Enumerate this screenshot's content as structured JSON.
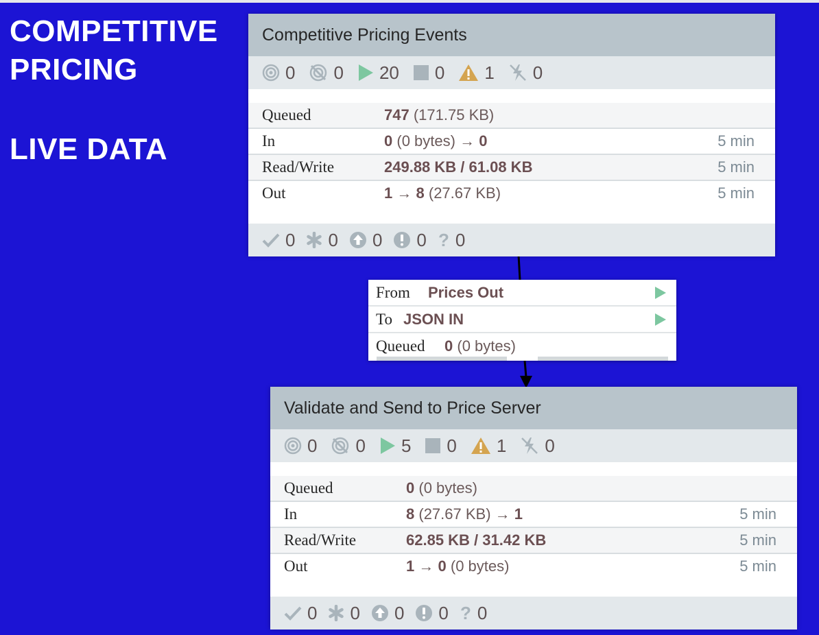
{
  "label": {
    "line1": "COMPETITIVE",
    "line2": "PRICING",
    "line3": "LIVE DATA"
  },
  "groups": [
    {
      "title": "Competitive Pricing Events",
      "counts": {
        "transmitting": "0",
        "not_transmitting": "0",
        "running": "20",
        "stopped": "0",
        "invalid": "1",
        "disabled": "0"
      },
      "stats": {
        "queued": {
          "label": "Queued",
          "count": "747",
          "size": "(171.75 KB)"
        },
        "in": {
          "label": "In",
          "count": "0",
          "size": "(0 bytes)",
          "arrow": "→",
          "extra": "0",
          "time": "5 min"
        },
        "rw": {
          "label": "Read/Write",
          "value": "249.88 KB / 61.08 KB",
          "time": "5 min"
        },
        "out": {
          "label": "Out",
          "count": "1",
          "arrow": "→",
          "extra": "8",
          "size": "(27.67 KB)",
          "time": "5 min"
        }
      },
      "footer": {
        "up_to_date": "0",
        "locally_modified": "0",
        "stale": "0",
        "sync_failure": "0",
        "unknown": "0"
      }
    },
    {
      "title": "Validate and Send to Price Server",
      "counts": {
        "transmitting": "0",
        "not_transmitting": "0",
        "running": "5",
        "stopped": "0",
        "invalid": "1",
        "disabled": "0"
      },
      "stats": {
        "queued": {
          "label": "Queued",
          "count": "0",
          "size": "(0 bytes)"
        },
        "in": {
          "label": "In",
          "count": "8",
          "size": "(27.67 KB)",
          "arrow": "→",
          "extra": "1",
          "time": "5 min"
        },
        "rw": {
          "label": "Read/Write",
          "value": "62.85 KB / 31.42 KB",
          "time": "5 min"
        },
        "out": {
          "label": "Out",
          "count": "1",
          "arrow": "→",
          "extra": "0",
          "size": "(0 bytes)",
          "time": "5 min"
        }
      },
      "footer": {
        "up_to_date": "0",
        "locally_modified": "0",
        "stale": "0",
        "sync_failure": "0",
        "unknown": "0"
      }
    }
  ],
  "connection": {
    "from_label": "From",
    "from_value": "Prices Out",
    "to_label": "To",
    "to_value": "JSON IN",
    "queued_label": "Queued",
    "queued_count": "0",
    "queued_size": "(0 bytes)"
  },
  "icons": {
    "transmitting": "transmitting-icon",
    "not_transmitting": "not-transmitting-icon",
    "running": "play-icon",
    "stopped": "stop-icon",
    "invalid": "warning-icon",
    "disabled": "disabled-icon",
    "up_to_date": "check-icon",
    "locally_modified": "asterisk-icon",
    "stale": "arrow-up-circle-icon",
    "sync_failure": "exclamation-circle-icon",
    "unknown": "question-icon"
  },
  "colors": {
    "background": "#1c14d4",
    "header": "#b8c4cb",
    "running": "#7dc7a0",
    "warning": "#d4a450",
    "value": "#6b4f52"
  }
}
